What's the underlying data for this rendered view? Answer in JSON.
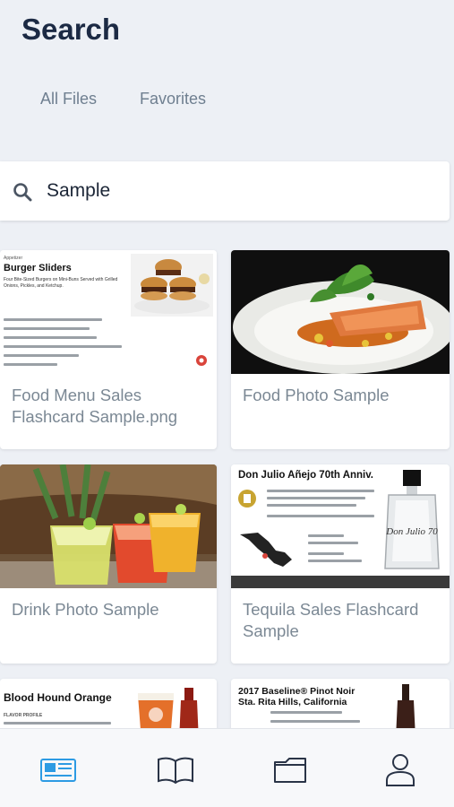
{
  "header": {
    "title": "Search"
  },
  "tabs": [
    {
      "label": "All Files"
    },
    {
      "label": "Favorites"
    }
  ],
  "search": {
    "value": "Sample",
    "icon": "search-icon"
  },
  "results": [
    {
      "label": "Food Menu Sales Flashcard Sample.png",
      "thumb": {
        "category": "Appetizer",
        "heading": "Burger Sliders",
        "subheading": "Four Bite-Sized Burgers on Mini-Buns Served with Grilled Onions, Pickles, and Ketchup."
      }
    },
    {
      "label": "Food Photo Sample"
    },
    {
      "label": "Drink Photo Sample"
    },
    {
      "label": "Tequila Sales Flashcard Sample",
      "thumb": {
        "heading": "Don Julio Añejo 70th Anniv.",
        "bottle_text": "Don Julio 70"
      }
    },
    {
      "label": "",
      "thumb": {
        "heading": "Blood Hound Orange",
        "subheading": "FLAVOR PROFILE"
      }
    },
    {
      "label": "",
      "thumb": {
        "heading": "2017 Baseline® Pinot Noir",
        "subheading": "Sta. Rita Hills, California"
      }
    }
  ],
  "bottom_nav": [
    {
      "icon": "news-icon",
      "active": true
    },
    {
      "icon": "book-icon",
      "active": false
    },
    {
      "icon": "folder-icon",
      "active": false
    },
    {
      "icon": "profile-icon",
      "active": false
    }
  ],
  "colors": {
    "active": "#2d9be3",
    "inactive": "#2a3447",
    "title": "#1c2a44"
  }
}
